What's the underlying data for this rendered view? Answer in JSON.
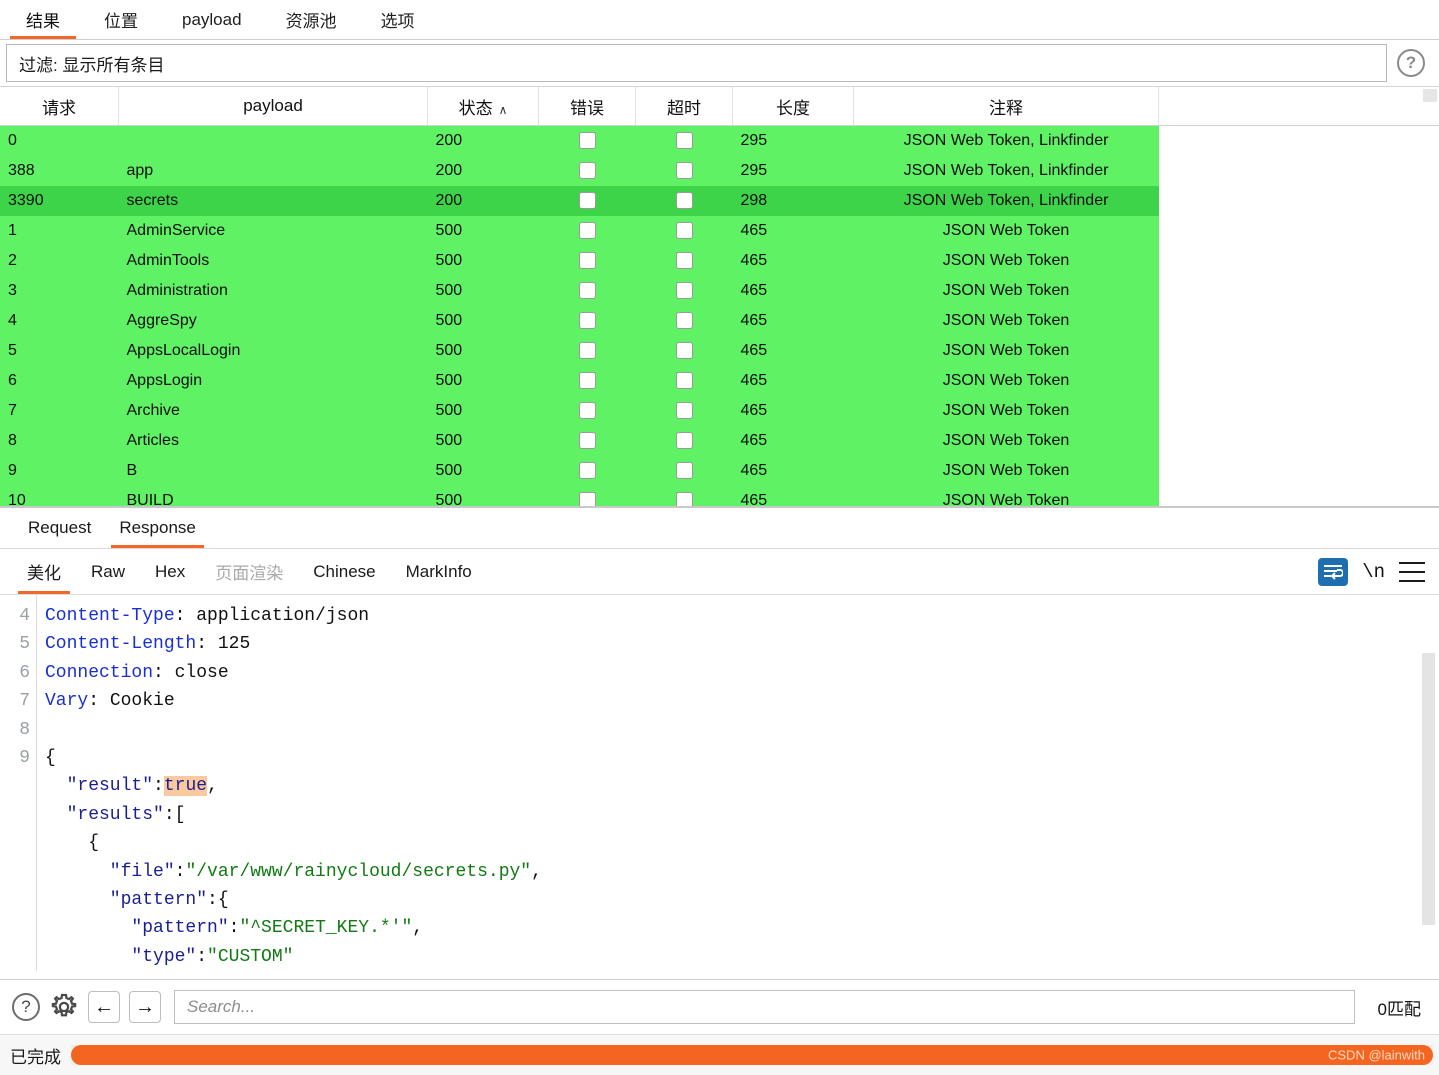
{
  "top_tabs": [
    {
      "label": "结果",
      "active": true
    },
    {
      "label": "位置",
      "active": false
    },
    {
      "label": "payload",
      "active": false
    },
    {
      "label": "资源池",
      "active": false
    },
    {
      "label": "选项",
      "active": false
    }
  ],
  "filter": {
    "text": "过滤: 显示所有条目",
    "help_icon": "help-circle-icon",
    "help_glyph": "?"
  },
  "results_table": {
    "columns": [
      "请求",
      "payload",
      "状态",
      "错误",
      "超时",
      "长度",
      "注释"
    ],
    "sort_column": "状态",
    "sort_caret": "∧",
    "rows": [
      {
        "req": "0",
        "payload": "",
        "status": "200",
        "error": false,
        "timeout": false,
        "length": "295",
        "note": "JSON Web Token, Linkfinder",
        "selected": false
      },
      {
        "req": "388",
        "payload": "app",
        "status": "200",
        "error": false,
        "timeout": false,
        "length": "295",
        "note": "JSON Web Token, Linkfinder",
        "selected": false
      },
      {
        "req": "3390",
        "payload": "secrets",
        "status": "200",
        "error": false,
        "timeout": false,
        "length": "298",
        "note": "JSON Web Token, Linkfinder",
        "selected": true
      },
      {
        "req": "1",
        "payload": "AdminService",
        "status": "500",
        "error": false,
        "timeout": false,
        "length": "465",
        "note": "JSON Web Token",
        "selected": false
      },
      {
        "req": "2",
        "payload": "AdminTools",
        "status": "500",
        "error": false,
        "timeout": false,
        "length": "465",
        "note": "JSON Web Token",
        "selected": false
      },
      {
        "req": "3",
        "payload": "Administration",
        "status": "500",
        "error": false,
        "timeout": false,
        "length": "465",
        "note": "JSON Web Token",
        "selected": false
      },
      {
        "req": "4",
        "payload": "AggreSpy",
        "status": "500",
        "error": false,
        "timeout": false,
        "length": "465",
        "note": "JSON Web Token",
        "selected": false
      },
      {
        "req": "5",
        "payload": "AppsLocalLogin",
        "status": "500",
        "error": false,
        "timeout": false,
        "length": "465",
        "note": "JSON Web Token",
        "selected": false
      },
      {
        "req": "6",
        "payload": "AppsLogin",
        "status": "500",
        "error": false,
        "timeout": false,
        "length": "465",
        "note": "JSON Web Token",
        "selected": false
      },
      {
        "req": "7",
        "payload": "Archive",
        "status": "500",
        "error": false,
        "timeout": false,
        "length": "465",
        "note": "JSON Web Token",
        "selected": false
      },
      {
        "req": "8",
        "payload": "Articles",
        "status": "500",
        "error": false,
        "timeout": false,
        "length": "465",
        "note": "JSON Web Token",
        "selected": false
      },
      {
        "req": "9",
        "payload": "B",
        "status": "500",
        "error": false,
        "timeout": false,
        "length": "465",
        "note": "JSON Web Token",
        "selected": false
      },
      {
        "req": "10",
        "payload": "BUILD",
        "status": "500",
        "error": false,
        "timeout": false,
        "length": "465",
        "note": "JSON Web Token",
        "selected": false
      }
    ]
  },
  "message_tabs": [
    {
      "label": "Request",
      "active": false
    },
    {
      "label": "Response",
      "active": true
    }
  ],
  "view_tabs": [
    {
      "label": "美化",
      "active": true,
      "disabled": false
    },
    {
      "label": "Raw",
      "active": false,
      "disabled": false
    },
    {
      "label": "Hex",
      "active": false,
      "disabled": false
    },
    {
      "label": "页面渲染",
      "active": false,
      "disabled": true
    },
    {
      "label": "Chinese",
      "active": false,
      "disabled": false
    },
    {
      "label": "MarkInfo",
      "active": false,
      "disabled": false
    }
  ],
  "view_tools": {
    "wrap_icon": "word-wrap-icon",
    "newline_label": "\\n",
    "menu_icon": "hamburger-menu-icon"
  },
  "editor": {
    "line_numbers": [
      "4",
      "5",
      "6",
      "7",
      "8",
      "9",
      "",
      "",
      "",
      "",
      "",
      "",
      ""
    ],
    "lines": [
      {
        "num": "4",
        "segments": [
          {
            "t": "Content-Type",
            "c": "hdr"
          },
          {
            "t": ": application/json",
            "c": "plain"
          }
        ]
      },
      {
        "num": "5",
        "segments": [
          {
            "t": "Content-Length",
            "c": "hdr"
          },
          {
            "t": ": 125",
            "c": "plain"
          }
        ]
      },
      {
        "num": "6",
        "segments": [
          {
            "t": "Connection",
            "c": "hdr"
          },
          {
            "t": ": close",
            "c": "plain"
          }
        ]
      },
      {
        "num": "7",
        "segments": [
          {
            "t": "Vary",
            "c": "hdr"
          },
          {
            "t": ": Cookie",
            "c": "plain"
          }
        ]
      },
      {
        "num": "8",
        "segments": []
      },
      {
        "num": "9",
        "segments": [
          {
            "t": "{",
            "c": "plain"
          }
        ]
      },
      {
        "num": "",
        "segments": [
          {
            "t": "  \"result\"",
            "c": "key"
          },
          {
            "t": ":",
            "c": "plain"
          },
          {
            "t": "true",
            "c": "bool"
          },
          {
            "t": ",",
            "c": "plain"
          }
        ]
      },
      {
        "num": "",
        "segments": [
          {
            "t": "  \"results\"",
            "c": "key"
          },
          {
            "t": ":[",
            "c": "plain"
          }
        ]
      },
      {
        "num": "",
        "segments": [
          {
            "t": "    {",
            "c": "plain"
          }
        ]
      },
      {
        "num": "",
        "segments": [
          {
            "t": "      \"file\"",
            "c": "key"
          },
          {
            "t": ":",
            "c": "plain"
          },
          {
            "t": "\"/var/www/rainycloud/secrets.py\"",
            "c": "str"
          },
          {
            "t": ",",
            "c": "plain"
          }
        ]
      },
      {
        "num": "",
        "segments": [
          {
            "t": "      \"pattern\"",
            "c": "key"
          },
          {
            "t": ":{",
            "c": "plain"
          }
        ]
      },
      {
        "num": "",
        "segments": [
          {
            "t": "        \"pattern\"",
            "c": "key"
          },
          {
            "t": ":",
            "c": "plain"
          },
          {
            "t": "\"^SECRET_KEY.*'\"",
            "c": "str"
          },
          {
            "t": ",",
            "c": "plain"
          }
        ]
      },
      {
        "num": "",
        "segments": [
          {
            "t": "        \"type\"",
            "c": "key"
          },
          {
            "t": ":",
            "c": "plain"
          },
          {
            "t": "\"CUSTOM\"",
            "c": "str"
          }
        ]
      }
    ]
  },
  "search_bar": {
    "help_glyph": "?",
    "back_glyph": "←",
    "forward_glyph": "→",
    "placeholder": "Search...",
    "value": "",
    "match_count": "0匹配"
  },
  "status_bar": {
    "text": "已完成",
    "progress_percent": 100,
    "watermark": "CSDN @lainwith"
  },
  "colors": {
    "accent": "#f2682a",
    "row_green": "#5ef264",
    "row_green_selected": "#3ed44a",
    "highlight_orange": "#fac9a0",
    "wrap_button_blue": "#1f6fb0",
    "progress_orange": "#f4651f"
  }
}
